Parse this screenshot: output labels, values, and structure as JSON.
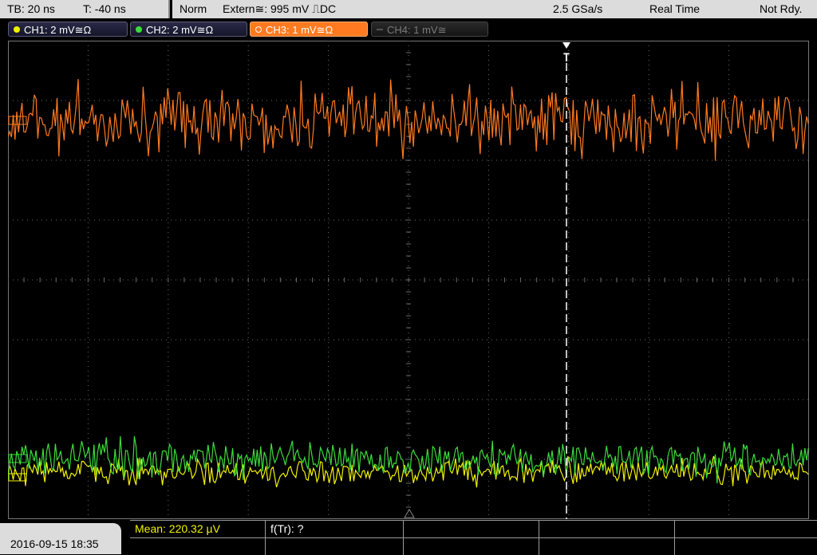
{
  "status": {
    "timebase": "TB: 20 ns",
    "trigger_time": "T: -40 ns",
    "mode": "Norm",
    "trigger_source": "Extern≅: 995 mV ⎍DC",
    "sample_rate": "2.5 GSa/s",
    "acquisition": "Real Time",
    "state": "Not Rdy."
  },
  "channels": [
    {
      "label": "CH1: 2 mV≅Ω",
      "color": "#f2f200",
      "active": false,
      "enabled": true
    },
    {
      "label": "CH2: 2 mV≅Ω",
      "color": "#3cdc3c",
      "active": false,
      "enabled": true
    },
    {
      "label": "CH3: 1 mV≅Ω",
      "color": "#ff7a20",
      "active": true,
      "enabled": true
    },
    {
      "label": "CH4: 1 mV≅",
      "color": "#7a7a7a",
      "active": false,
      "enabled": false
    }
  ],
  "trigger_marker": "T",
  "datetime": "2016-09-15 18:35",
  "measurements": {
    "mean": "Mean: 220.32 µV",
    "ftr": "f(Tr): ?"
  },
  "colors": {
    "ch1": "#f2f200",
    "ch2": "#3cdc3c",
    "ch3": "#ff7a20",
    "grid": "#6a6a6a",
    "panel": "#dcdcdc"
  }
}
